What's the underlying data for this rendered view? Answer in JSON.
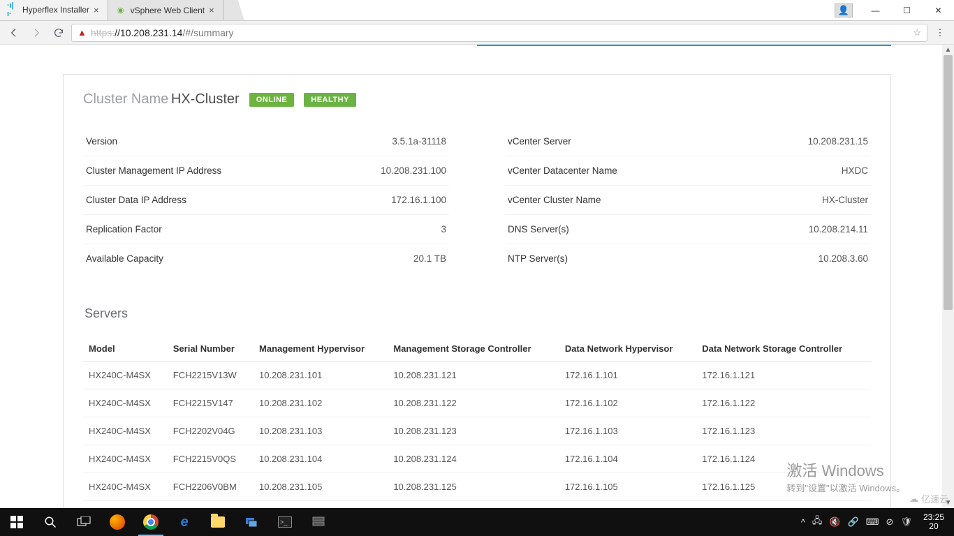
{
  "browser": {
    "tabs": [
      {
        "title": "Hyperflex Installer",
        "favicon": "cisco",
        "active": true
      },
      {
        "title": "vSphere Web Client",
        "favicon": "vsphere",
        "active": false
      }
    ],
    "url_scheme": "https:",
    "url_host": "//10.208.231.14",
    "url_path": "/#/summary"
  },
  "cluster": {
    "label": "Cluster Name",
    "name": "HX-Cluster",
    "status": "ONLINE",
    "health": "HEALTHY"
  },
  "summary_left": [
    {
      "key": "Version",
      "value": "3.5.1a-31118"
    },
    {
      "key": "Cluster Management IP Address",
      "value": "10.208.231.100"
    },
    {
      "key": "Cluster Data IP Address",
      "value": "172.16.1.100"
    },
    {
      "key": "Replication Factor",
      "value": "3"
    },
    {
      "key": "Available Capacity",
      "value": "20.1 TB"
    }
  ],
  "summary_right": [
    {
      "key": "vCenter Server",
      "value": "10.208.231.15"
    },
    {
      "key": "vCenter Datacenter Name",
      "value": "HXDC"
    },
    {
      "key": "vCenter Cluster Name",
      "value": "HX-Cluster"
    },
    {
      "key": "DNS Server(s)",
      "value": "10.208.214.11"
    },
    {
      "key": "NTP Server(s)",
      "value": "10.208.3.60"
    }
  ],
  "servers_title": "Servers",
  "servers_headers": [
    "Model",
    "Serial Number",
    "Management Hypervisor",
    "Management Storage Controller",
    "Data Network Hypervisor",
    "Data Network Storage Controller"
  ],
  "servers": [
    {
      "model": "HX240C-M4SX",
      "serial": "FCH2215V13W",
      "mh": "10.208.231.101",
      "msc": "10.208.231.121",
      "dnh": "172.16.1.101",
      "dnsc": "172.16.1.121"
    },
    {
      "model": "HX240C-M4SX",
      "serial": "FCH2215V147",
      "mh": "10.208.231.102",
      "msc": "10.208.231.122",
      "dnh": "172.16.1.102",
      "dnsc": "172.16.1.122"
    },
    {
      "model": "HX240C-M4SX",
      "serial": "FCH2202V04G",
      "mh": "10.208.231.103",
      "msc": "10.208.231.123",
      "dnh": "172.16.1.103",
      "dnsc": "172.16.1.123"
    },
    {
      "model": "HX240C-M4SX",
      "serial": "FCH2215V0QS",
      "mh": "10.208.231.104",
      "msc": "10.208.231.124",
      "dnh": "172.16.1.104",
      "dnsc": "172.16.1.124"
    },
    {
      "model": "HX240C-M4SX",
      "serial": "FCH2206V0BM",
      "mh": "10.208.231.105",
      "msc": "10.208.231.125",
      "dnh": "172.16.1.105",
      "dnsc": "172.16.1.125"
    }
  ],
  "watermark": {
    "line1": "激活 Windows",
    "line2": "转到\"设置\"以激活 Windows。"
  },
  "brandmark": "亿速云",
  "taskbar": {
    "time": "23:25",
    "date_prefix": "20"
  }
}
